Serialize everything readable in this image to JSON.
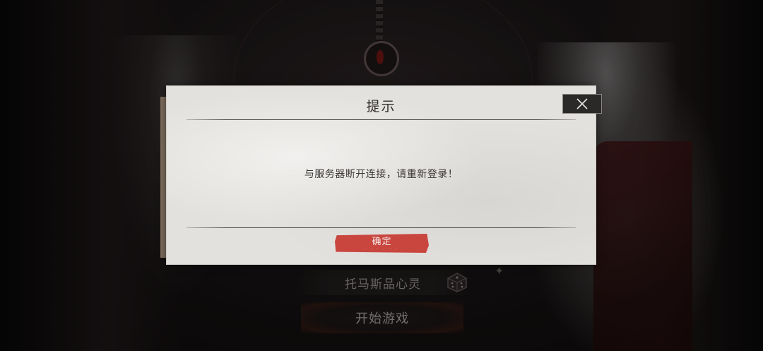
{
  "dialog": {
    "title": "提示",
    "message": "与服务器断开连接，请重新登录！",
    "confirm_label": "确定",
    "confirm_sublabel": "· · · · · ·",
    "close_icon": "close-icon"
  },
  "game": {
    "character_name": "托马斯品心灵",
    "start_label": "开始游戏",
    "dice_icon": "dice-icon",
    "star_icon": "star-icon"
  },
  "colors": {
    "accent_red": "#c9463f",
    "dialog_bg": "#e3e1dd",
    "background": "#0f0d0d"
  }
}
